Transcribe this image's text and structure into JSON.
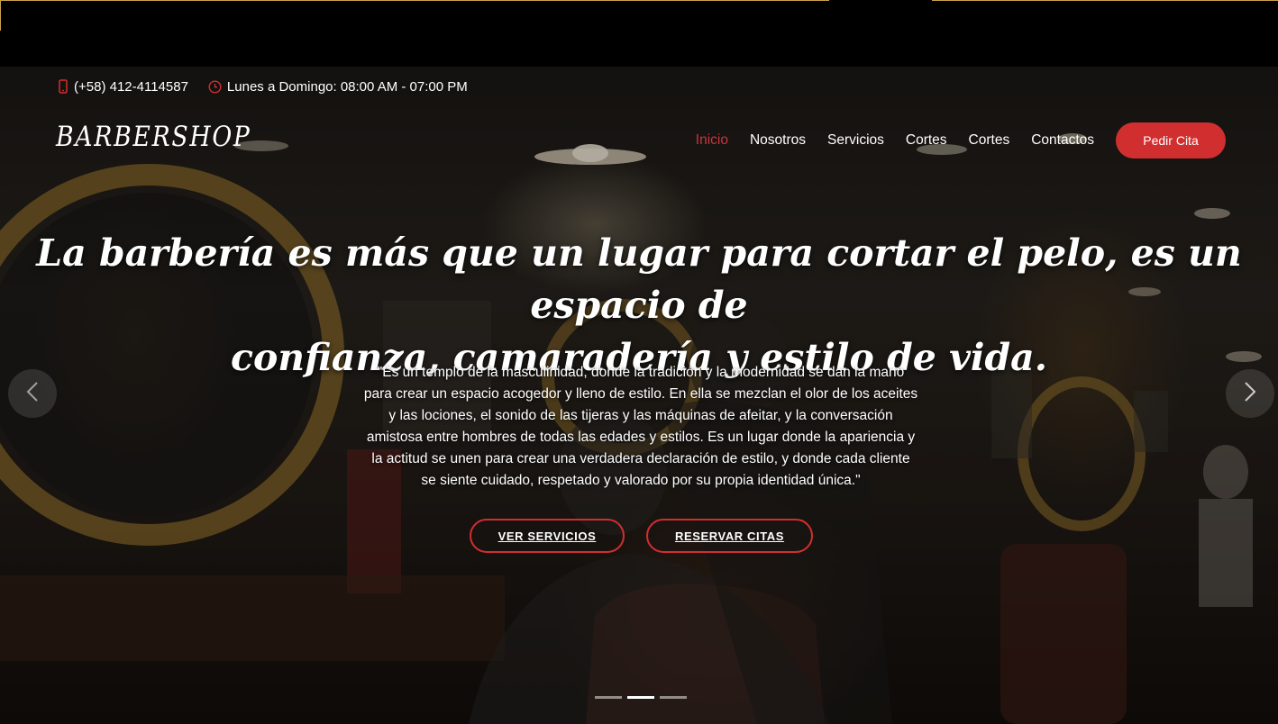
{
  "topbar": {
    "phone": "(+58) 412-4114587",
    "hours": "Lunes a Domingo: 08:00 AM - 07:00 PM",
    "phone_icon": "phone-icon",
    "clock_icon": "clock-icon"
  },
  "header": {
    "logo": "BARBERSHOP",
    "nav": [
      "Inicio",
      "Nosotros",
      "Servicios",
      "Cortes",
      "Cortes",
      "Contactos"
    ],
    "active_item": "Inicio",
    "cta": "Pedir Cita"
  },
  "hero": {
    "headline_line1": "La barbería es más que un lugar para cortar el pelo, es un espacio de",
    "headline_line2": "confianza, camaradería y estilo de vida.",
    "paragraph_lines": [
      "\"Es un templo de la masculinidad, donde la tradición y la modernidad se dan la mano",
      "para crear un espacio acogedor y lleno de estilo. En ella se mezclan el olor de los aceites",
      "y las lociones, el sonido de las tijeras y las máquinas de afeitar, y la conversación",
      "amistosa entre hombres de todas las edades y estilos. Es un lugar donde la apariencia y",
      "la actitud se unen para crear una verdadera declaración de estilo, y donde cada cliente",
      "se siente cuidado, respetado y valorado por su propia identidad única.\""
    ],
    "button_services": "VER SERVICIOS",
    "button_book": "RESERVAR CITAS"
  },
  "carousel": {
    "prev_icon": "chevron-left-icon",
    "next_icon": "chevron-right-icon",
    "slide_count": 3,
    "active_slide": 2
  },
  "colors": {
    "accent": "#d12f2f",
    "active_nav": "#c8363a",
    "gold_line": "#c9a24a"
  }
}
